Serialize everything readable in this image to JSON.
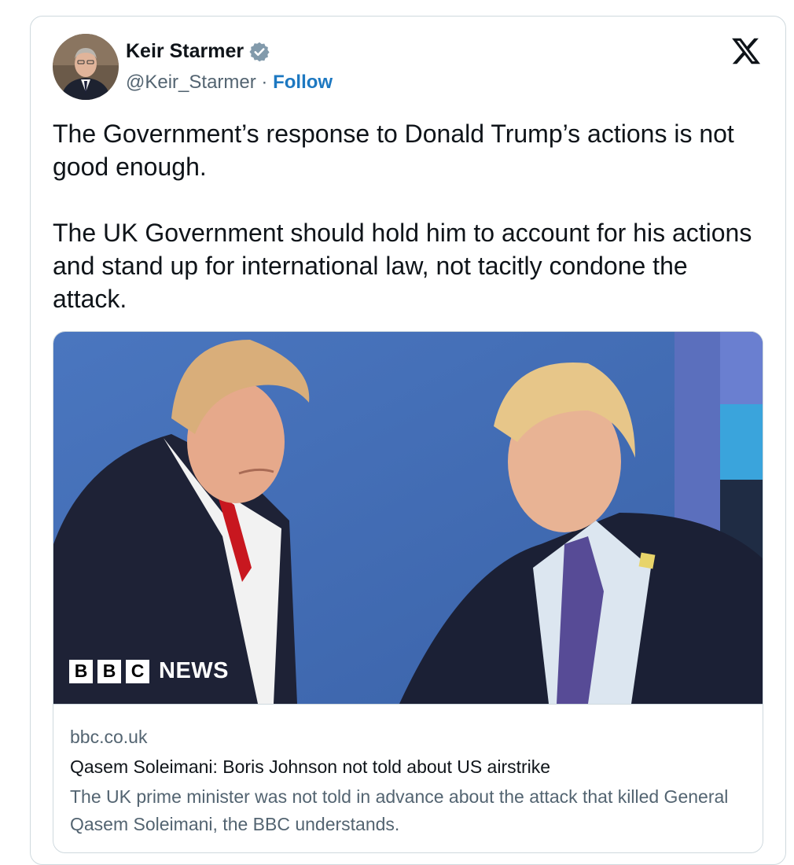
{
  "author": {
    "display_name": "Keir Starmer",
    "handle": "@Keir_Starmer",
    "separator": "·",
    "follow_label": "Follow",
    "verified": true
  },
  "platform": {
    "logo": "x-logo-icon"
  },
  "tweet": {
    "paragraphs": [
      "The Government’s response to Donald Trump’s actions is not good enough.",
      "The UK Government should hold him to account for his actions and stand up for international law, not tacitly condone the attack."
    ]
  },
  "link_card": {
    "image_watermark": {
      "letters": [
        "B",
        "B",
        "C"
      ],
      "word": "NEWS"
    },
    "domain": "bbc.co.uk",
    "title": "Qasem Soleimani: Boris Johnson not told about US airstrike",
    "description": "The UK prime minister was not told in advance about the attack that killed General Qasem Soleimani, the BBC understands."
  },
  "colors": {
    "text_primary": "#0f1419",
    "text_secondary": "#536471",
    "follow_link": "#1d78c1",
    "verified_badge": "#829aab",
    "border": "#cfd9de",
    "photo_background": "#4169b3"
  }
}
